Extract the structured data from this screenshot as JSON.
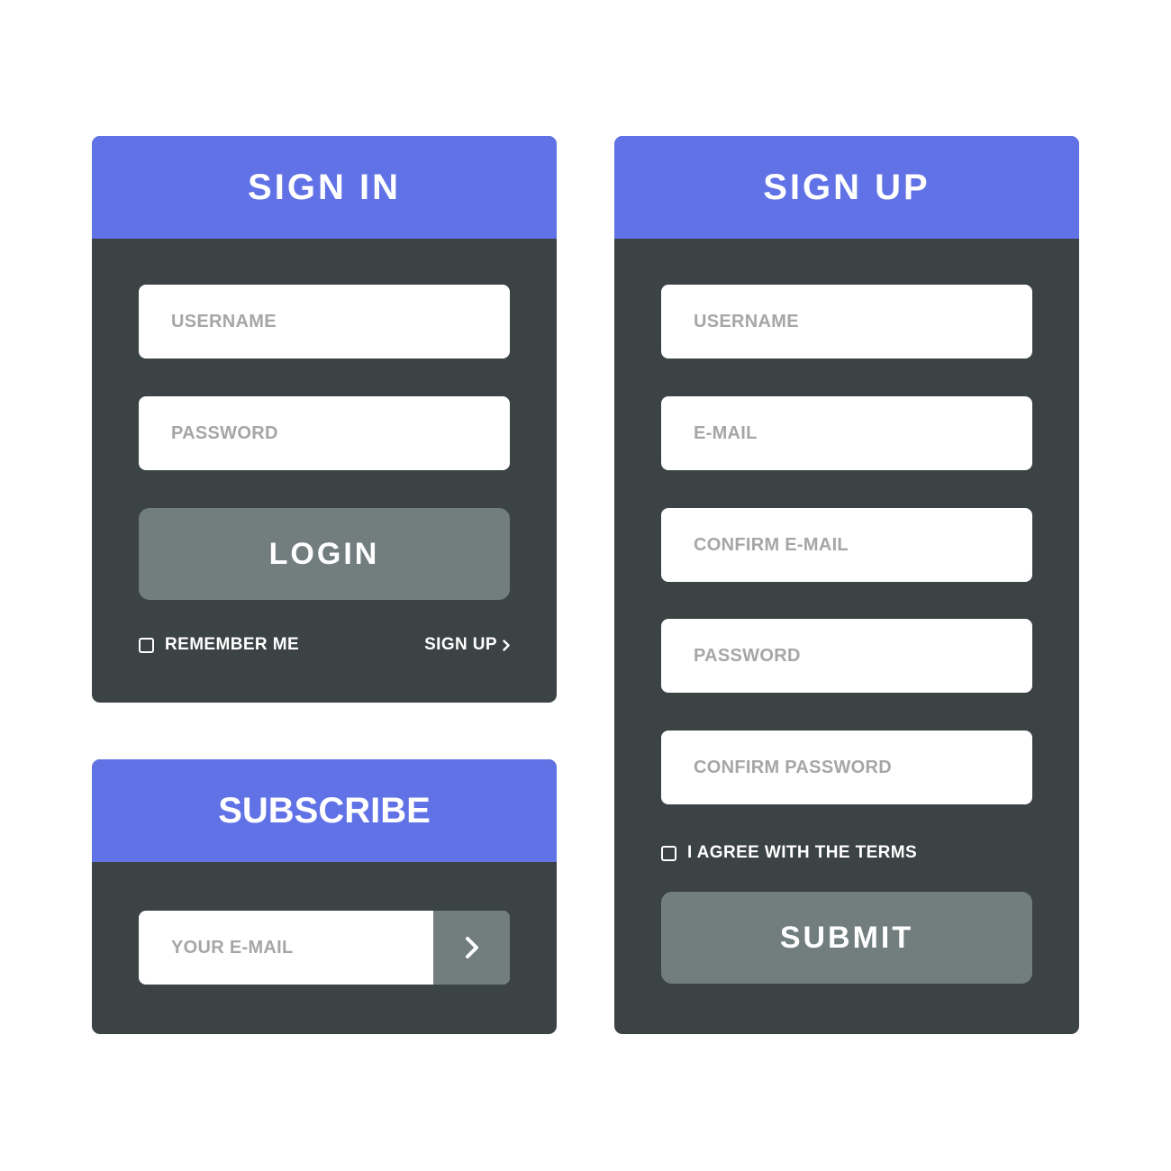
{
  "colors": {
    "header": "#6072e6",
    "panel": "#3c4344",
    "button": "#727e7e",
    "field": "#ffffff",
    "placeholder": "#a6a6a6"
  },
  "sign_in": {
    "title": "SIGN IN",
    "username_placeholder": "USERNAME",
    "password_placeholder": "PASSWORD",
    "login_label": "LOGIN",
    "remember_label": "REMEMBER ME",
    "signup_link": "SIGN UP",
    "signup_link_icon": "chevron-right-icon"
  },
  "subscribe": {
    "title": "SUBSCRIBE",
    "email_placeholder": "YOUR E-MAIL",
    "submit_icon": "chevron-right-icon"
  },
  "sign_up": {
    "title": "SIGN UP",
    "username_placeholder": "USERNAME",
    "email_placeholder": "E-MAIL",
    "confirm_email_placeholder": "CONFIRM E-MAIL",
    "password_placeholder": "PASSWORD",
    "confirm_password_placeholder": "CONFIRM PASSWORD",
    "terms_label": "I AGREE WITH THE TERMS",
    "submit_label": "SUBMIT"
  }
}
